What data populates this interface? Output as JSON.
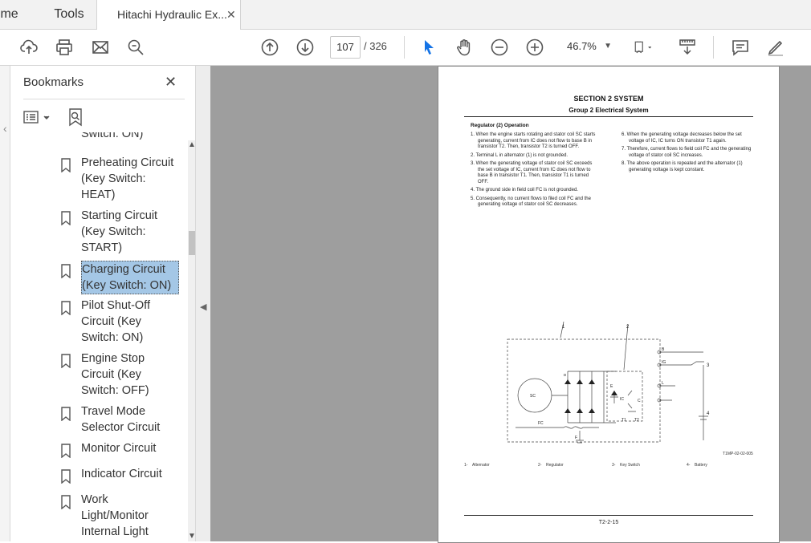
{
  "tabs": {
    "home": "Home",
    "tools": "Tools",
    "document": "Hitachi Hydraulic Ex...",
    "close_glyph": "✕"
  },
  "toolbar": {
    "page_current": "107",
    "page_total": "/ 326",
    "zoom": "46.7%",
    "icons": [
      "cloud-upload-icon",
      "print-icon",
      "email-icon",
      "zoom-search-icon",
      "page-up-icon",
      "page-down-icon",
      "select-cursor-icon",
      "hand-tool-icon",
      "zoom-out-icon",
      "zoom-in-icon",
      "page-fit-icon",
      "scroll-mode-icon",
      "comment-icon",
      "sign-pen-icon"
    ]
  },
  "bookmarks": {
    "title": "Bookmarks",
    "close_glyph": "✕",
    "items": [
      {
        "label": "Switch: ON)"
      },
      {
        "label": "Preheating Circuit (Key Switch: HEAT)"
      },
      {
        "label": "Starting Circuit (Key Switch: START)"
      },
      {
        "label": "Charging Circuit (Key Switch: ON)",
        "selected": true
      },
      {
        "label": "Pilot Shut-Off Circuit (Key Switch: ON)"
      },
      {
        "label": "Engine Stop Circuit (Key Switch: OFF)"
      },
      {
        "label": "Travel Mode Selector Circuit"
      },
      {
        "label": "Monitor Circuit"
      },
      {
        "label": "Indicator Circuit"
      },
      {
        "label": "Work Light/Monitor Internal Light"
      }
    ]
  },
  "document": {
    "section_title": "SECTION 2 SYSTEM",
    "section_subtitle": "Group 2 Electrical System",
    "heading": "Regulator (2) Operation",
    "left_steps": [
      "1. When the engine starts rotating and stator coil SC starts generating, current from IC does not flow to base B in transistor T2. Then, transistor T2 is turned OFF.",
      "2. Terminal L in alternator (1) is not grounded.",
      "3. When the generating voltage of stator coil SC exceeds the set voltage of IC, current from IC does not flow to base B in transistor T1. Then, transistor T1 is turned OFF.",
      "4. The ground side in field coil FC is not grounded.",
      "5. Consequently, no current flows to filed coil FC and the generating voltage of stator coil SC decreases."
    ],
    "right_steps": [
      "6. When the generating voltage decreases below the set voltage of IC, IC turns ON transistor T1 again.",
      "7. Therefore, current flows to field coil FC and the generating voltage of stator coil SC increases.",
      "8. The above operation is repeated and the alternator (1) generating voltage is kept constant."
    ],
    "figure_id": "T1MP-02-02-005",
    "figure_labels": {
      "n1": "1",
      "n2": "2",
      "n3": "3",
      "n4": "4",
      "sc": "SC",
      "fc": "FC",
      "b": "B",
      "ig": "IG",
      "l": "L",
      "ic": "IC",
      "t1": "T1",
      "t2": "T2",
      "e": "E",
      "c": "C",
      "f": "F",
      "d": "D"
    },
    "legend": [
      {
        "num": "1-",
        "text": "Alternator"
      },
      {
        "num": "2-",
        "text": "Regulator"
      },
      {
        "num": "3-",
        "text": "Key Switch"
      },
      {
        "num": "4-",
        "text": "Battery"
      }
    ],
    "page_number": "T2-2-15"
  },
  "colors": {
    "canvas_bg": "#9e9e9e",
    "selection": "#a4c7e6",
    "accent_cursor": "#1473e6"
  }
}
